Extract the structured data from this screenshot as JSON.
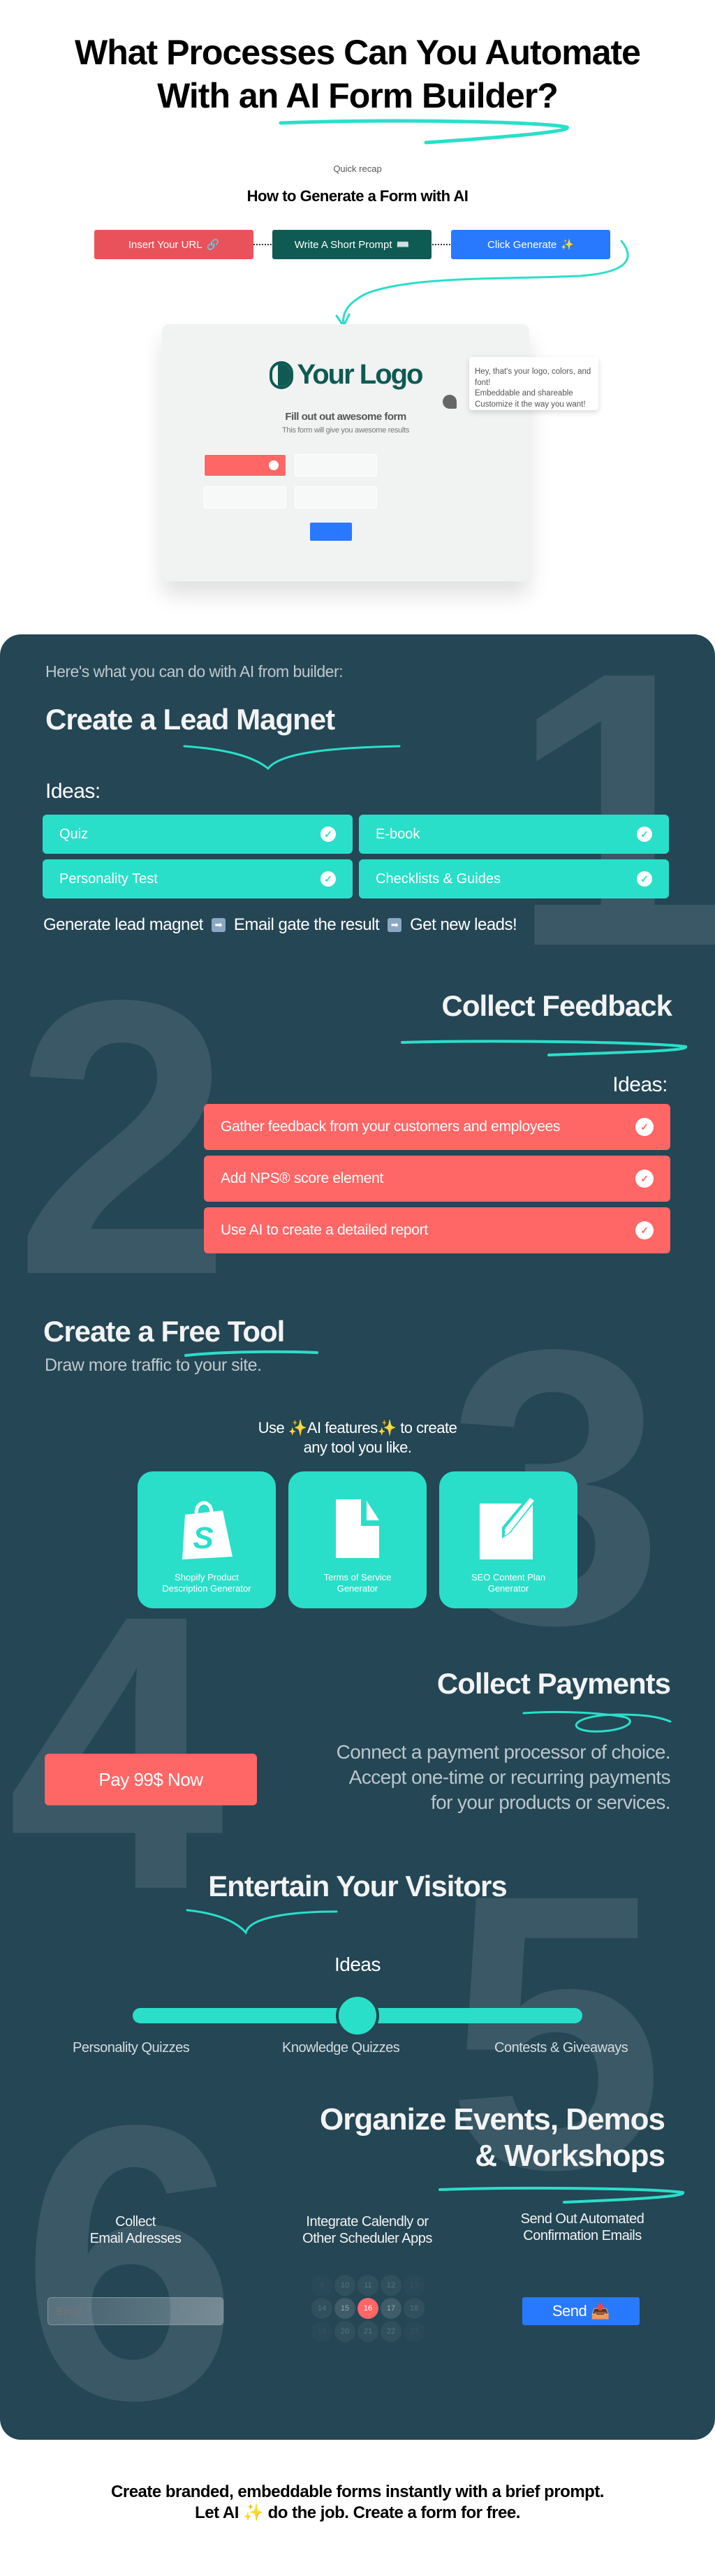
{
  "header": {
    "title_line1": "What Processes Can You Automate",
    "title_line2": "With an AI Form Builder?"
  },
  "recap": {
    "label": "Quick recap",
    "title": "How to Generate a Form with AI",
    "steps": [
      {
        "label": "Insert Your URL",
        "emoji": "🔗"
      },
      {
        "label": "Write A Short Prompt",
        "emoji": "⌨️"
      },
      {
        "label": "Click Generate",
        "emoji": "✨"
      }
    ]
  },
  "form_preview": {
    "logo_text": "Your Logo",
    "title": "Fill out out awesome form",
    "subtitle": "This form will give you awesome results",
    "tooltip_lines": [
      "Hey, that's your logo, colors, and font!",
      "Embeddable and shareable",
      "Customize it the way you want!"
    ]
  },
  "features": {
    "intro": "Here's what you can do with AI from builder:",
    "lead_magnet": {
      "number": "1",
      "title_prefix": "Create a ",
      "title_highlight": "Lead Magnet",
      "ideas_label": "Ideas:",
      "ideas": [
        "Quiz",
        "E-book",
        "Personality Test",
        "Checklists & Guides"
      ],
      "flow": [
        "Generate  lead magnet",
        "Email gate the result",
        "Get new leads!"
      ],
      "flow_arrow": "➡"
    },
    "feedback": {
      "number": "2",
      "title": "Collect Feedback",
      "ideas_label": "Ideas:",
      "ideas": [
        "Gather feedback from your customers and employees",
        "Add NPS® score element",
        "Use AI to create a detailed report"
      ]
    },
    "free_tool": {
      "number": "3",
      "title_prefix": "Create a ",
      "title_highlight": "Free Tool",
      "subtitle": "Draw more traffic to your site.",
      "prompt_line1": "Use ✨AI features✨ to create",
      "prompt_line2": "any tool you like.",
      "tools": [
        {
          "icon": "shopify-bag-icon",
          "line1": "Shopify Product",
          "line2": "Description Generator"
        },
        {
          "icon": "document-icon",
          "line1": "Terms of Service",
          "line2": "Generator"
        },
        {
          "icon": "pencil-edit-icon",
          "line1": "SEO Content Plan",
          "line2": "Generator"
        }
      ]
    },
    "payments": {
      "number": "4",
      "title_prefix": "Collect ",
      "title_highlight": "Payments",
      "button": "Pay 99$ Now",
      "line1": "Connect a payment processor of choice.",
      "line2": "Accept one-time or recurring payments",
      "line3": "for your products or services."
    },
    "entertain": {
      "number": "5",
      "title_highlight": "Entertain",
      "title_suffix": " Your Visitors",
      "ideas_label": "Ideas",
      "slider_value": 0.5,
      "options": [
        "Personality Quizzes",
        "Knowledge Quizzes",
        "Contests & Giveaways"
      ]
    },
    "events": {
      "number": "6",
      "title_line1": "Organize Events, Demos",
      "title_line2": "& Workshops",
      "columns": [
        {
          "line1": "Collect",
          "line2": "Email Adresses"
        },
        {
          "line1": "Integrate Calendly or",
          "line2": "Other Scheduler Apps"
        },
        {
          "line1": "Send Out Automated",
          "line2": "Confirmation Emails"
        }
      ],
      "email_placeholder": "Email",
      "calendar_rows": [
        [
          "9",
          "10",
          "11",
          "12",
          "13"
        ],
        [
          "14",
          "15",
          "16",
          "17",
          "18"
        ],
        [
          "19",
          "20",
          "21",
          "22",
          "23"
        ]
      ],
      "calendar_selected": "16",
      "send_label": "Send",
      "send_emoji": "📤"
    }
  },
  "footer": {
    "line1": "Create branded, embeddable forms instantly with a brief prompt.",
    "line2_prefix": "Let AI ",
    "line2_emoji": "✨",
    "line2_suffix": " do the job. Create a form for free."
  },
  "colors": {
    "teal": "#2adfc9",
    "coral": "#ff6666",
    "blue": "#2979ff",
    "dark_bg": "#244655",
    "brand_green": "#0f5a53"
  }
}
